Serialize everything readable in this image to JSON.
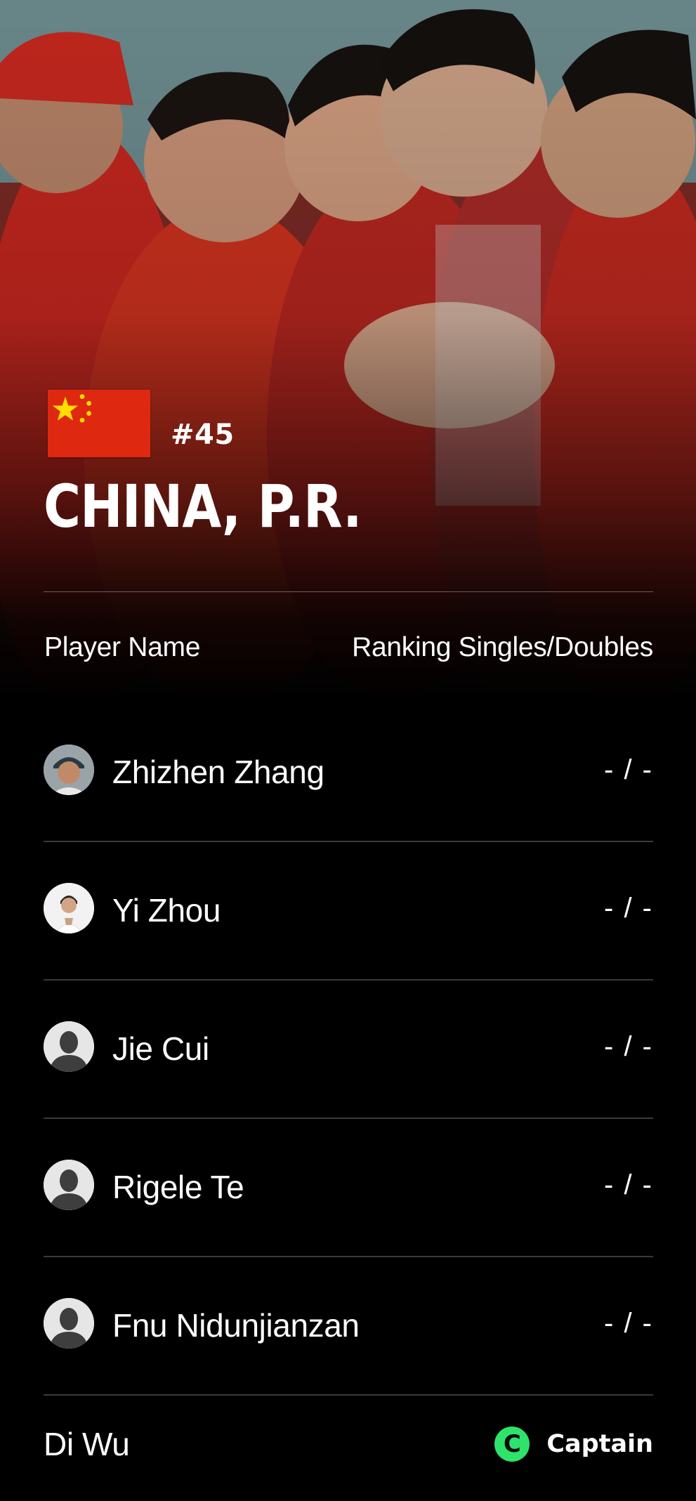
{
  "team": {
    "rank": "#45",
    "country": "CHINA, P.R."
  },
  "table": {
    "header_player": "Player Name",
    "header_ranking": "Ranking Singles/Doubles"
  },
  "players": [
    {
      "name": "Zhizhen Zhang",
      "ranking": "- / -",
      "avatar": "photo"
    },
    {
      "name": "Yi Zhou",
      "ranking": "- / -",
      "avatar": "photo"
    },
    {
      "name": "Jie Cui",
      "ranking": "- / -",
      "avatar": "placeholder"
    },
    {
      "name": "Rigele Te",
      "ranking": "- / -",
      "avatar": "placeholder"
    },
    {
      "name": "Fnu Nidunjianzan",
      "ranking": "- / -",
      "avatar": "placeholder"
    }
  ],
  "captain": {
    "name": "Di Wu",
    "badge_letter": "C",
    "badge_label": "Captain",
    "badge_color": "#2ee36a"
  },
  "colors": {
    "background": "#000000",
    "flag_red": "#de2910",
    "flag_yellow": "#ffde00",
    "divider": "#3a3a3a"
  }
}
